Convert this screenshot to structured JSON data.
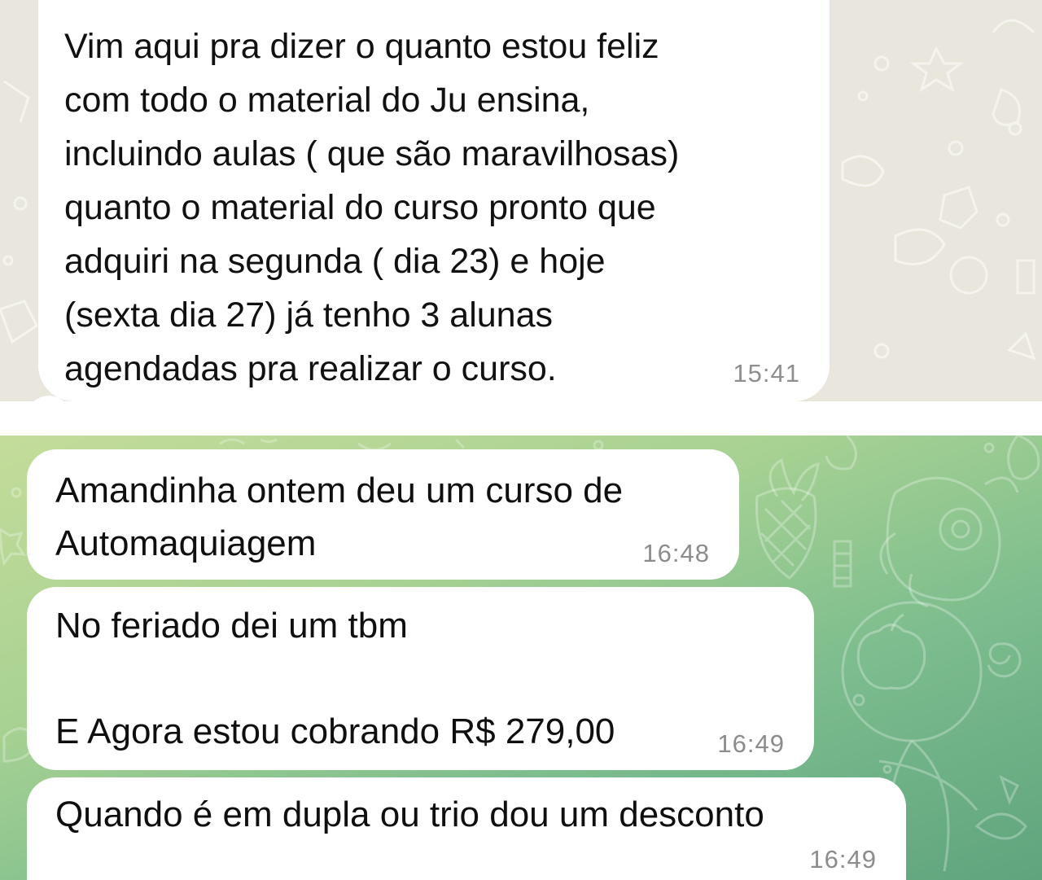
{
  "chat_top": {
    "theme": {
      "wallpaper": "#e9e6de",
      "bubble": "#ffffff",
      "time_color": "#8e8e8e"
    },
    "message": {
      "text": "Vim aqui pra dizer o quanto estou feliz\ncom todo o material do Ju ensina,\nincluindo aulas ( que são maravilhosas)\nquanto o material do curso pronto que\nadquiri na segunda ( dia 23) e hoje\n(sexta dia 27) já tenho 3 alunas\nagendadas pra realizar o curso.",
      "time": "15:41"
    }
  },
  "chat_bottom": {
    "theme": {
      "wallpaper_start": "#c4dc9a",
      "wallpaper_end": "#5fa47e",
      "bubble": "#ffffff",
      "time_color": "#8c8c8c"
    },
    "messages": [
      {
        "text": "Amandinha ontem deu um curso de\nAutomaquiagem",
        "time": "16:48"
      },
      {
        "text": "No feriado dei um tbm\n\nE Agora estou cobrando R$ 279,00",
        "time": "16:49"
      },
      {
        "text": "Quando é em dupla ou trio dou um desconto",
        "time": "16:49"
      }
    ]
  }
}
